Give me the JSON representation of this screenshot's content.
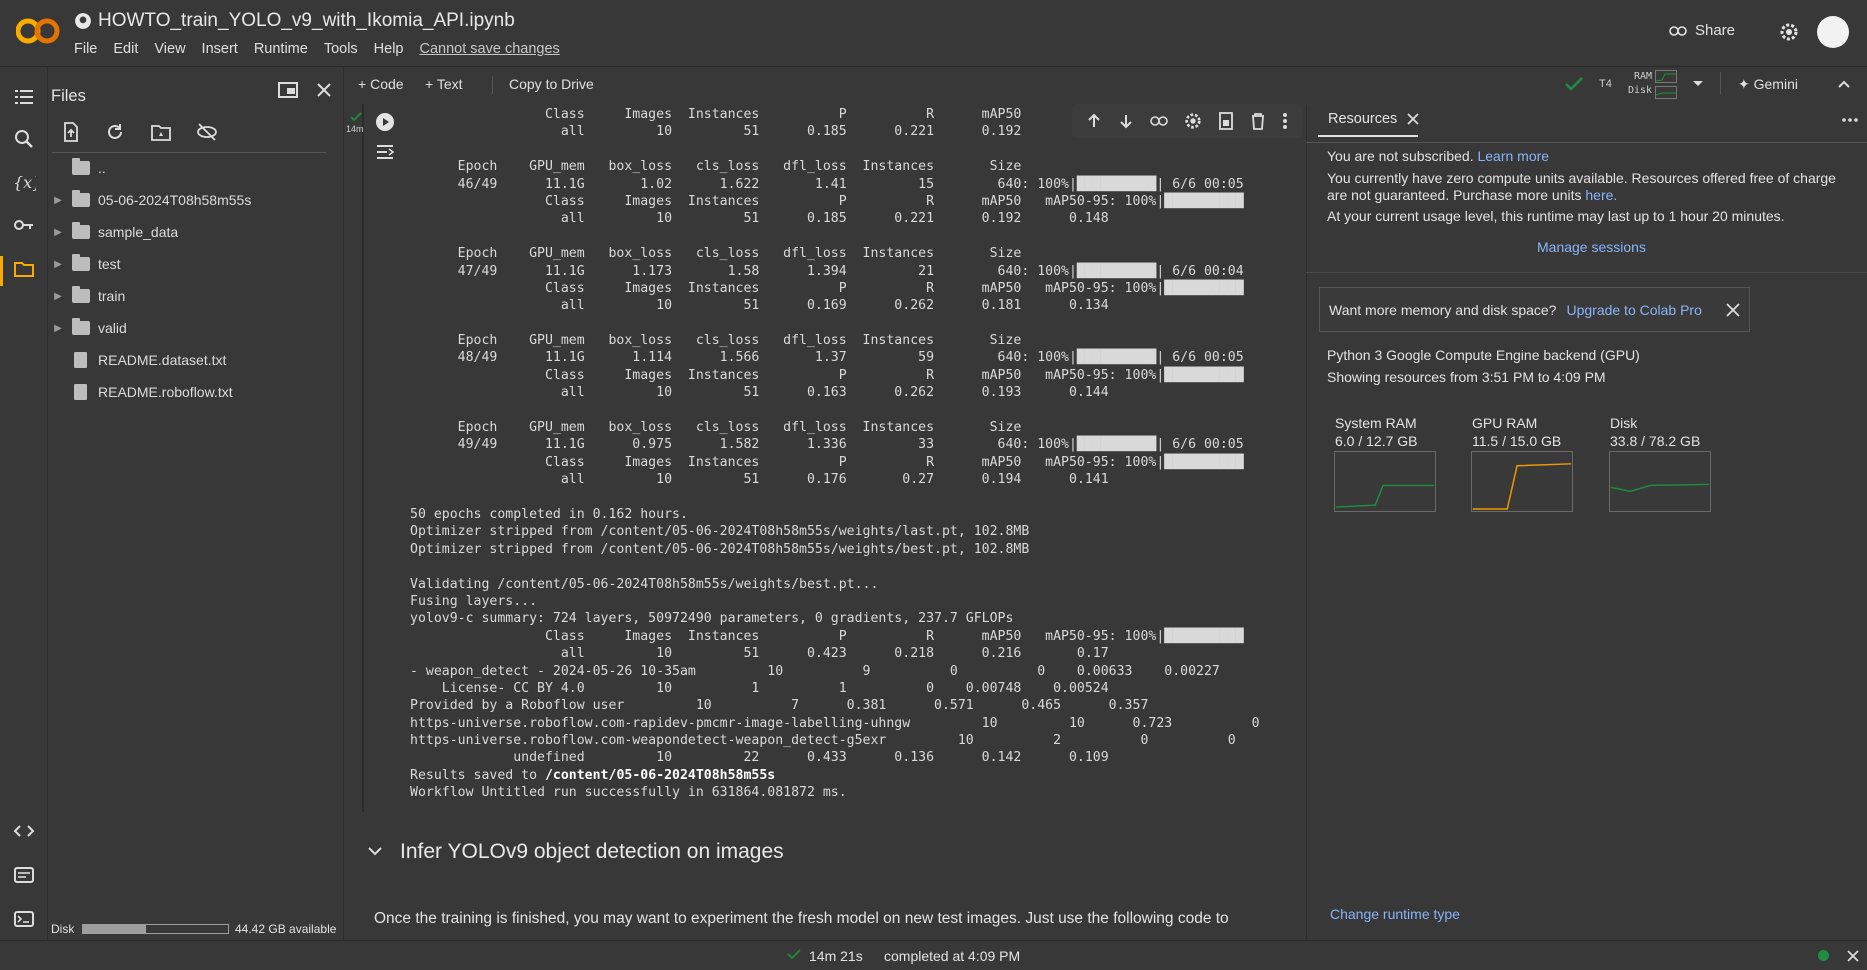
{
  "header": {
    "notebook_title": "HOWTO_train_YOLO_v9_with_Ikomia_API.ipynb",
    "menu": [
      "File",
      "Edit",
      "View",
      "Insert",
      "Runtime",
      "Tools",
      "Help"
    ],
    "unsaved": "Cannot save changes",
    "share_label": "Share",
    "brand_colors": {
      "logo": "#f9ab00"
    }
  },
  "files_panel": {
    "title": "Files",
    "items": [
      {
        "label": "..",
        "kind": "folder-up"
      },
      {
        "label": "05-06-2024T08h58m55s",
        "kind": "folder"
      },
      {
        "label": "sample_data",
        "kind": "folder"
      },
      {
        "label": "test",
        "kind": "folder"
      },
      {
        "label": "train",
        "kind": "folder"
      },
      {
        "label": "valid",
        "kind": "folder"
      },
      {
        "label": "README.dataset.txt",
        "kind": "file"
      },
      {
        "label": "README.roboflow.txt",
        "kind": "file"
      }
    ],
    "disk_label": "Disk",
    "disk_available": "44.42 GB available",
    "disk_used_fraction": 0.43
  },
  "toolbar": {
    "add_code": "Code",
    "add_text": "Text",
    "copy_drive": "Copy to Drive",
    "runtime": "T4",
    "ram_label": "RAM",
    "disk_label": "Disk",
    "gemini": "Gemini"
  },
  "cell": {
    "exec_time": "14m",
    "output_lines": [
      "                 Class     Images  Instances          P          R      mAP50",
      "                   all         10         51      0.185      0.221      0.192",
      "",
      "      Epoch    GPU_mem   box_loss   cls_loss   dfl_loss  Instances       Size",
      "      46/49      11.1G       1.02      1.622       1.41         15        640: 100%|██████████| 6/6 00:05",
      "                 Class     Images  Instances          P          R      mAP50   mAP50-95: 100%|██████████",
      "                   all         10         51      0.185      0.221      0.192      0.148",
      "",
      "      Epoch    GPU_mem   box_loss   cls_loss   dfl_loss  Instances       Size",
      "      47/49      11.1G      1.173       1.58      1.394         21        640: 100%|██████████| 6/6 00:04",
      "                 Class     Images  Instances          P          R      mAP50   mAP50-95: 100%|██████████",
      "                   all         10         51      0.169      0.262      0.181      0.134",
      "",
      "      Epoch    GPU_mem   box_loss   cls_loss   dfl_loss  Instances       Size",
      "      48/49      11.1G      1.114      1.566       1.37         59        640: 100%|██████████| 6/6 00:05",
      "                 Class     Images  Instances          P          R      mAP50   mAP50-95: 100%|██████████",
      "                   all         10         51      0.163      0.262      0.193      0.144",
      "",
      "      Epoch    GPU_mem   box_loss   cls_loss   dfl_loss  Instances       Size",
      "      49/49      11.1G      0.975      1.582      1.336         33        640: 100%|██████████| 6/6 00:05",
      "                 Class     Images  Instances          P          R      mAP50   mAP50-95: 100%|██████████",
      "                   all         10         51      0.176       0.27      0.194      0.141",
      "",
      "50 epochs completed in 0.162 hours.",
      "Optimizer stripped from /content/05-06-2024T08h58m55s/weights/last.pt, 102.8MB",
      "Optimizer stripped from /content/05-06-2024T08h58m55s/weights/best.pt, 102.8MB",
      "",
      "Validating /content/05-06-2024T08h58m55s/weights/best.pt...",
      "Fusing layers...",
      "yolov9-c summary: 724 layers, 50972490 parameters, 0 gradients, 237.7 GFLOPs",
      "                 Class     Images  Instances          P          R      mAP50   mAP50-95: 100%|██████████",
      "                   all         10         51      0.423      0.218      0.216       0.17",
      "- weapon_detect - 2024-05-26 10-35am         10          9          0          0    0.00633    0.00227",
      "    License- CC BY 4.0         10          1          1          0    0.00748    0.00524",
      "Provided by a Roboflow user         10          7      0.381      0.571      0.465      0.357",
      "https-universe.roboflow.com-rapidev-pmcmr-image-labelling-uhngw         10         10      0.723          0",
      "https-universe.roboflow.com-weapondetect-weapon_detect-g5exr         10          2          0          0",
      "             undefined         10         22      0.433      0.136      0.142      0.109",
      "Results saved to /content/05-06-2024T08h58m55s",
      "Workflow Untitled run successfully in 631864.081872 ms."
    ]
  },
  "section": {
    "heading": "Infer YOLOv9 object detection on images",
    "text": "Once the training is finished, you may want to experiment the fresh model on new test images. Just use the following code to"
  },
  "resources": {
    "tab_label": "Resources",
    "not_subscribed": "You are not subscribed.",
    "learn_more": "Learn more",
    "zero_units_line1": "You currently have zero compute units available. Resources offered free of charge",
    "zero_units_line2": "are not guaranteed. Purchase more units",
    "here": "here.",
    "runtime_limit": "At your current usage level, this runtime may last up to 1 hour 20 minutes.",
    "manage_sessions": "Manage sessions",
    "banner_text": "Want more memory and disk space?",
    "upgrade": "Upgrade to Colab Pro",
    "backend": "Python 3 Google Compute Engine backend (GPU)",
    "range": "Showing resources from 3:51 PM to 4:09 PM",
    "gauges": [
      {
        "label": "System RAM",
        "value": "6.0 / 12.7 GB",
        "color": "#1e8e3e"
      },
      {
        "label": "GPU RAM",
        "value": "11.5 / 15.0 GB",
        "color": "#f29900"
      },
      {
        "label": "Disk",
        "value": "33.8 / 78.2 GB",
        "color": "#1e8e3e"
      }
    ],
    "change_runtime": "Change runtime type"
  },
  "status": {
    "elapsed": "14m 21s",
    "completed": "completed at 4:09 PM"
  }
}
